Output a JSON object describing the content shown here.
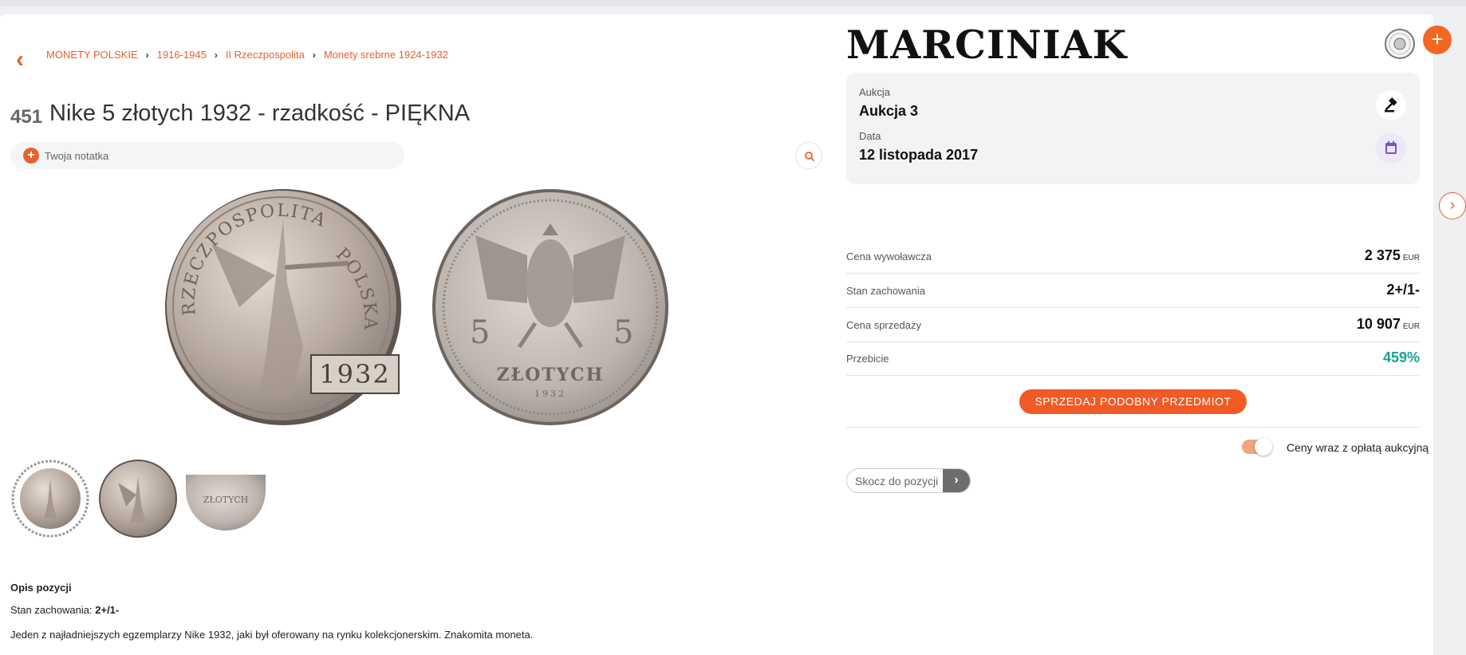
{
  "breadcrumb": {
    "items": [
      "MONETY POLSKIE",
      "1916-1945",
      "II Rzeczpospolita",
      "Monety srebrne 1924-1932"
    ],
    "separator": "›"
  },
  "lot": {
    "number": "451",
    "title": "Nike 5 złotych 1932 - rzadkość - PIĘKNA"
  },
  "note": {
    "label": "Twoja notatka"
  },
  "coin_obverse": {
    "legend_left": "RZECZPOSPOLITA",
    "legend_right": "POLSKA",
    "year": "1932"
  },
  "coin_reverse": {
    "left_digit": "5",
    "right_digit": "5",
    "denomination": "ZŁOTYCH",
    "year": "1932"
  },
  "description": {
    "title": "Opis pozycji",
    "state_label": "Stan zachowania:",
    "state_value": "2+/1-",
    "text": "Jeden z najładniejszych egzemplarzy Nike 1932, jaki był oferowany na rynku kolekcjonerskim. Znakomita moneta."
  },
  "auction_house": {
    "name": "MARCINIAK"
  },
  "auction_info": {
    "auction_label": "Aukcja",
    "auction_value": "Aukcja 3",
    "date_label": "Data",
    "date_value": "12 listopada 2017"
  },
  "details": [
    {
      "key": "Cena wywoławcza",
      "value": "2 375",
      "currency": "EUR"
    },
    {
      "key": "Stan zachowania",
      "value": "2+/1-",
      "currency": ""
    },
    {
      "key": "Cena sprzedaży",
      "value": "10 907",
      "currency": "EUR"
    },
    {
      "key": "Przebicie",
      "value": "459%",
      "currency": ""
    }
  ],
  "sell_button": "SPRZEDAJ PODOBNY PRZEDMIOT",
  "fee_toggle": {
    "label": "Ceny wraz z opłatą aukcyjną",
    "on": true
  },
  "jump": {
    "placeholder": "Skocz do pozycji",
    "go": "›"
  },
  "icons": {
    "back": "chevron-left-icon",
    "zoom": "magnifier-icon",
    "auction": "gavel-icon",
    "date": "calendar-icon",
    "add": "plus-icon",
    "next": "chevron-right-icon"
  },
  "colors": {
    "accent": "#f15a24",
    "green": "#17a493",
    "calendar": "#7b4fd6"
  }
}
